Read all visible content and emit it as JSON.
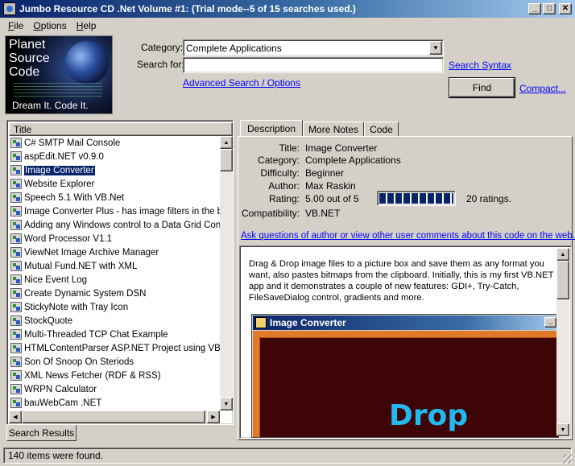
{
  "window": {
    "title": "Jumbo Resource CD .Net Volume #1: (Trial mode--5 of 15 searches used.)",
    "buttons": {
      "minimize": "_",
      "maximize": "□",
      "close": "✕"
    }
  },
  "menu": [
    {
      "key": "F",
      "rest": "ile"
    },
    {
      "key": "O",
      "rest": "ptions"
    },
    {
      "key": "H",
      "rest": "elp"
    }
  ],
  "logo": {
    "lines": [
      "Planet",
      "Source",
      "Code"
    ],
    "slogan": "Dream It.  Code It."
  },
  "search": {
    "category_label": "Category:",
    "category_value": "Complete Applications",
    "search_for_label": "Search for:",
    "search_value": "",
    "search_syntax_link": "Search Syntax",
    "advanced_link": "Advanced Search / Options",
    "find_button": "Find",
    "compact_link": "Compact..."
  },
  "results": {
    "column_header": "Title",
    "items": [
      "C# SMTP Mail Console",
      "aspEdit.NET v0.9.0",
      "Image Converter",
      "Website Explorer",
      "Speech 5.1 With VB.Net",
      "Image Converter Plus - has image filters in the byte",
      "Adding any Windows control to a Data Grid Contro",
      "Word Processor V1.1",
      "ViewNet Image Archive Manager",
      "Mutual Fund.NET with XML",
      "Nice Event Log",
      "Create Dynamic System DSN",
      "StickyNote with Tray Icon",
      "StockQuote",
      "Multi-Threaded TCP Chat Example",
      "HTMLContentParser ASP.NET Project using VB.N",
      "Son Of Snoop On Steriods",
      "XML News Fetcher  (RDF & RSS)",
      "WRPN Calculator",
      "bauWebCam .NET"
    ],
    "selected_index": 2,
    "tab_label": "Search Results"
  },
  "detail": {
    "tabs": [
      "Description",
      "More Notes",
      "Code"
    ],
    "active_tab": 0,
    "fields": [
      {
        "label": "Title:",
        "value": "Image Converter"
      },
      {
        "label": "Category:",
        "value": "Complete Applications"
      },
      {
        "label": "Difficulty:",
        "value": "Beginner"
      },
      {
        "label": "Author:",
        "value": "Max Raskin"
      },
      {
        "label": "Rating:",
        "value": "5.00 out of 5"
      },
      {
        "label": "Compatibility:",
        "value": "VB.NET"
      }
    ],
    "rating_fraction": 1.0,
    "ratings_count": "20 ratings.",
    "ask_link": "Ask questions of author or view other user comments about this code on the web....",
    "description": "Drag & Drop image files to a picture box and save them as any format you want, also pastes bitmaps from the clipboard. Initially, this is my first VB.NET app and it demonstrates a couple of new features: GDI+, Try-Catch, FileSaveDialog control, gradients and more.",
    "screenshot": {
      "window_title": "Image Converter",
      "drop_text": "Drop"
    }
  },
  "status": {
    "text": "140 items were found."
  }
}
